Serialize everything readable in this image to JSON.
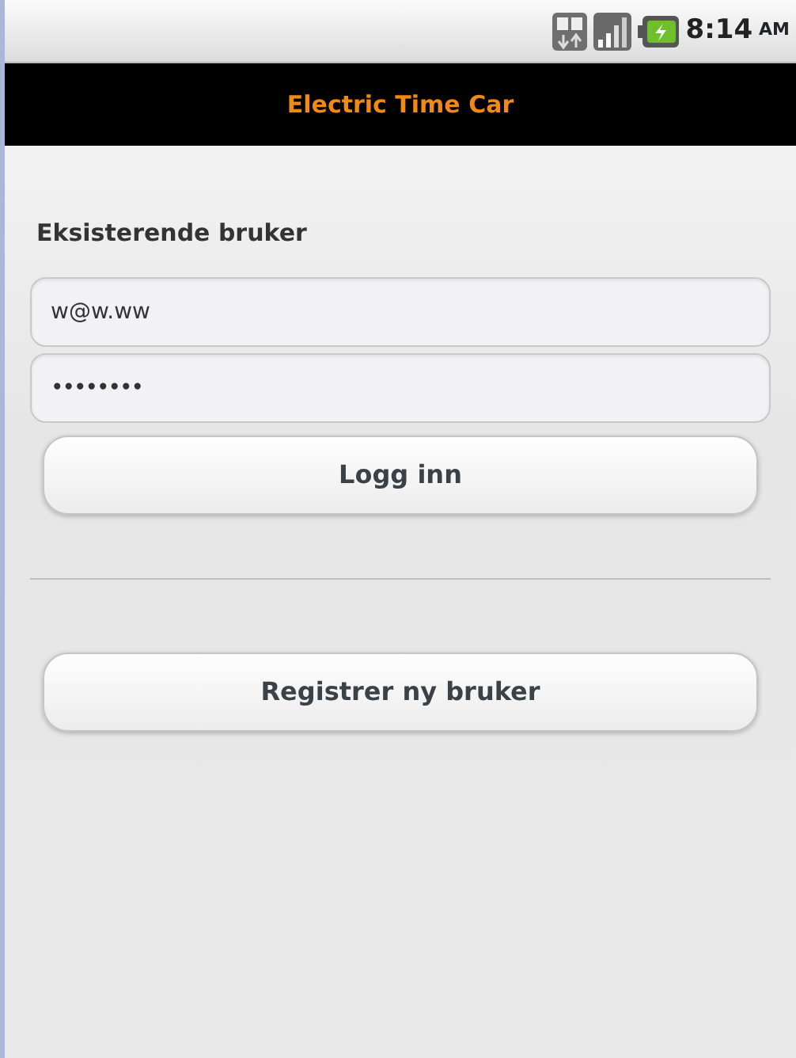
{
  "status_bar": {
    "time": "8:14",
    "meridiem": "AM"
  },
  "title_bar": {
    "title": "Electric Time Car"
  },
  "login": {
    "heading": "Eksisterende bruker",
    "fields": [
      {
        "kind": "text",
        "value": "w@w.ww"
      },
      {
        "kind": "password",
        "value": "••••••••"
      }
    ],
    "button": "Logg inn"
  },
  "register_button": "Registrer ny bruker"
}
